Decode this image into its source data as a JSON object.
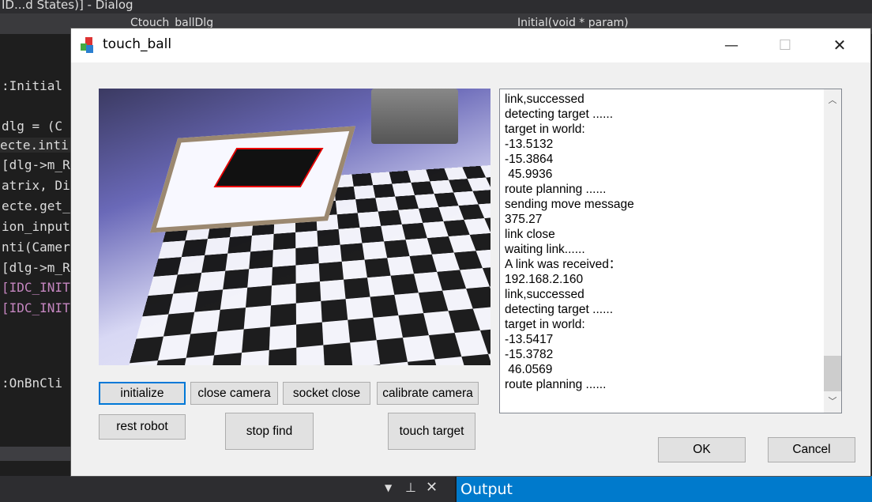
{
  "ide": {
    "title": "ID...d States)] - Dialog",
    "tabs": [
      "Ctouch_ballDlg",
      "Initial(void * param)"
    ],
    "code_lines": [
      {
        "text": ":Initial",
        "cls": ""
      },
      {
        "text": "dlg = (C",
        "cls": ""
      },
      {
        "text": "ecte.inti",
        "cls": "hl"
      },
      {
        "text": "[dlg->m_R",
        "cls": ""
      },
      {
        "text": "atrix, Di",
        "cls": ""
      },
      {
        "text": "ecte.get_",
        "cls": ""
      },
      {
        "text": "ion_input",
        "cls": ""
      },
      {
        "text": "nti(Camer",
        "cls": ""
      },
      {
        "text": "[dlg->m_R",
        "cls": ""
      },
      {
        "text": "[IDC_INIT",
        "cls": "mac"
      },
      {
        "text": "[IDC_INIT",
        "cls": "mac"
      },
      {
        "text": ":OnBnCli",
        "cls": ""
      }
    ],
    "output_label": "Output"
  },
  "dialog": {
    "title": "touch_ball",
    "log_lines": [
      "link,successed",
      "detecting target ......",
      "target in world:",
      "-13.5132",
      "-15.3864",
      " 45.9936",
      "route planning ......",
      "sending move message",
      "375.27",
      "link close",
      "waiting link......",
      "A link was received：",
      "192.168.2.160",
      "link,successed",
      "detecting target ......",
      "target in world:",
      "-13.5417",
      "-15.3782",
      " 46.0569",
      "route planning ......"
    ],
    "buttons": {
      "initialize": "initialize",
      "close_camera": "close camera",
      "socket_close": "socket close",
      "calibrate_camera": "calibrate camera",
      "rest_robot": "rest robot",
      "stop_find": "stop find",
      "touch_target": "touch target",
      "ok": "OK",
      "cancel": "Cancel"
    }
  }
}
